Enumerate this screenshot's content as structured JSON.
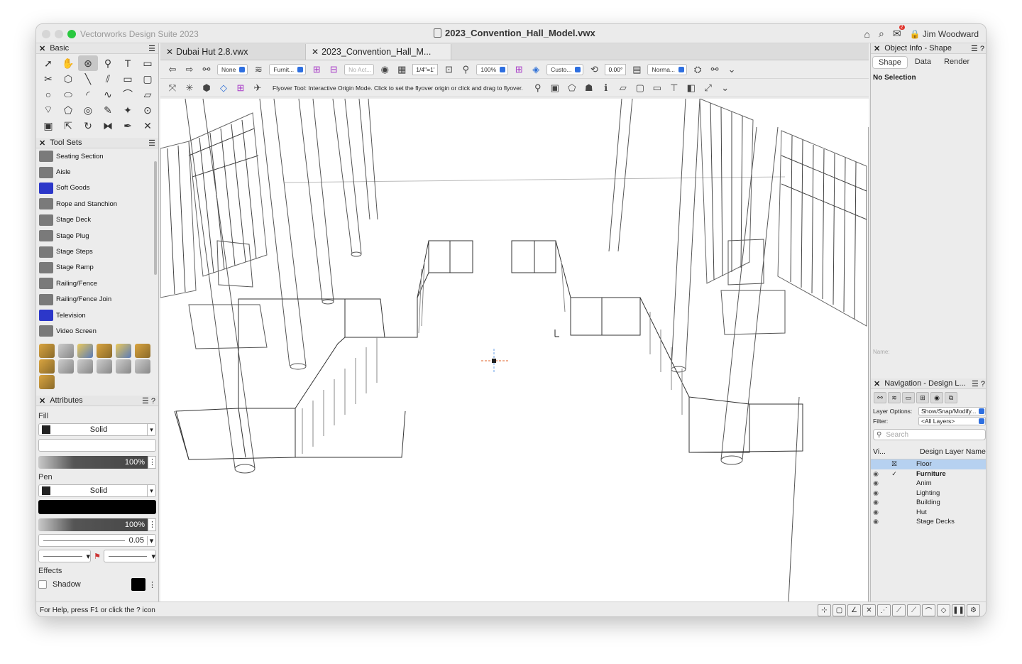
{
  "titlebar": {
    "app_title": "Vectorworks Design Suite 2023",
    "doc_title": "2023_Convention_Hall_Model.vwx",
    "user": "Jim Woodward",
    "icons": [
      "home-icon",
      "search-icon",
      "notification-icon",
      "lock-icon"
    ],
    "notification_count": "2"
  },
  "left": {
    "basic_title": "Basic",
    "toolsets_title": "Tool Sets",
    "toolsets": [
      {
        "label": "Seating Section"
      },
      {
        "label": "Aisle"
      },
      {
        "label": "Soft Goods"
      },
      {
        "label": "Rope and Stanchion"
      },
      {
        "label": "Stage Deck"
      },
      {
        "label": "Stage Plug"
      },
      {
        "label": "Stage Steps"
      },
      {
        "label": "Stage Ramp"
      },
      {
        "label": "Railing/Fence"
      },
      {
        "label": "Railing/Fence Join"
      },
      {
        "label": "Television"
      },
      {
        "label": "Video Screen"
      }
    ],
    "attributes_title": "Attributes",
    "fill_label": "Fill",
    "fill_style": "Solid",
    "fill_opacity": "100%",
    "pen_label": "Pen",
    "pen_style": "Solid",
    "pen_opacity": "100%",
    "line_weight": "0.05",
    "effects_label": "Effects",
    "shadow_label": "Shadow"
  },
  "tabs": [
    {
      "label": "Dubai Hut 2.8.vwx",
      "active": false
    },
    {
      "label": "2023_Convention_Hall_M...",
      "active": true
    }
  ],
  "toolbar": {
    "class_select": "None",
    "layer_select": "Furnit...",
    "action_select": "No Act...",
    "scale": "1/4\"=1'",
    "zoom": "100%",
    "view_select": "Custo...",
    "rotation": "0.00°",
    "render_select": "Norma...",
    "hint": "Flyover Tool: Interactive Origin Mode. Click to set the flyover origin or click and drag to flyover."
  },
  "right": {
    "oi_title": "Object Info - Shape",
    "oi_tabs": [
      "Shape",
      "Data",
      "Render"
    ],
    "no_selection": "No Selection",
    "name_label": "Name:",
    "nav_title": "Navigation - Design L...",
    "layer_options_label": "Layer Options:",
    "layer_options_value": "Show/Snap/Modify...",
    "filter_label": "Filter:",
    "filter_value": "<All Layers>",
    "search_placeholder": "Search",
    "col_vis": "Vi...",
    "col_name": "Design Layer Name",
    "layers": [
      {
        "name": "Floor",
        "selected": true,
        "active": false
      },
      {
        "name": "Furniture",
        "selected": false,
        "active": true
      },
      {
        "name": "Anim",
        "selected": false,
        "active": false
      },
      {
        "name": "Lighting",
        "selected": false,
        "active": false
      },
      {
        "name": "Building",
        "selected": false,
        "active": false
      },
      {
        "name": "Hut",
        "selected": false,
        "active": false
      },
      {
        "name": "Stage Decks",
        "selected": false,
        "active": false
      }
    ]
  },
  "status": {
    "help_text": "For Help, press F1 or click the ? icon"
  },
  "colors": {
    "accent": "#2e6fe0",
    "selection": "#b6d1f0",
    "origin_marker": "#e0632b"
  }
}
